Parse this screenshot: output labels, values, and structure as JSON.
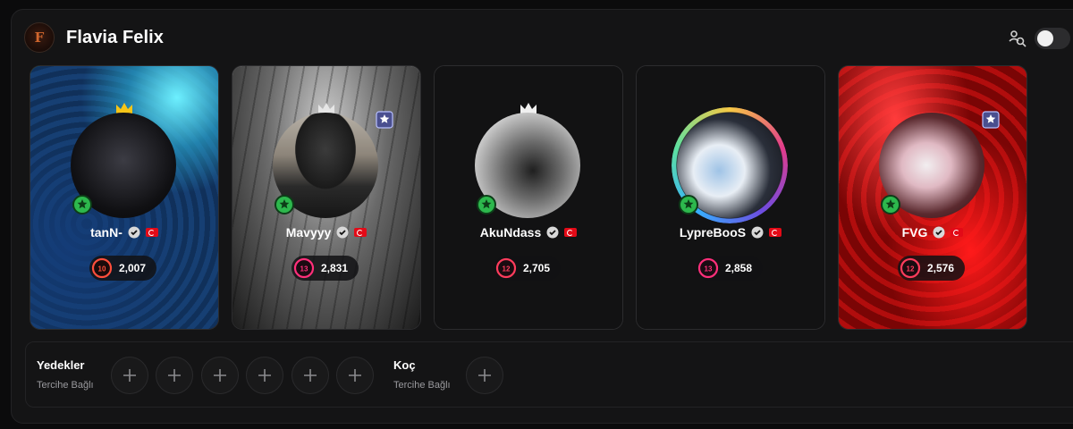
{
  "team": {
    "name": "Flavia Felix",
    "logo_icon": "team-logo-icon",
    "logo_letter": "F"
  },
  "controls": {
    "search_icon": "user-search-icon",
    "toggle_state": "off"
  },
  "players": [
    {
      "name": "tanN-",
      "level": "10",
      "elo": "2,007",
      "level_color": "#ff4e3b",
      "crown": true,
      "rank_badge": false
    },
    {
      "name": "Mavyyy",
      "level": "13",
      "elo": "2,831",
      "level_color": "#ff2f7a",
      "crown": true,
      "rank_badge": true
    },
    {
      "name": "AkuNdass",
      "level": "12",
      "elo": "2,705",
      "level_color": "#ff3c5c",
      "crown": true,
      "rank_badge": false
    },
    {
      "name": "LypreBooS",
      "level": "13",
      "elo": "2,858",
      "level_color": "#ff2f7a",
      "crown": false,
      "rank_badge": false
    },
    {
      "name": "FVG",
      "level": "12",
      "elo": "2,576",
      "level_color": "#ff3c5c",
      "crown": false,
      "rank_badge": true
    }
  ],
  "substitutes": {
    "title": "Yedekler",
    "caption": "Tercihe Bağlı",
    "slots": 6
  },
  "coach": {
    "title": "Koç",
    "caption": "Tercihe Bağlı",
    "slots": 1
  },
  "colors": {
    "crown": "#f5c518",
    "online": "#2db84d",
    "verified": "#d8d8d8",
    "flag": "#e30a17"
  }
}
